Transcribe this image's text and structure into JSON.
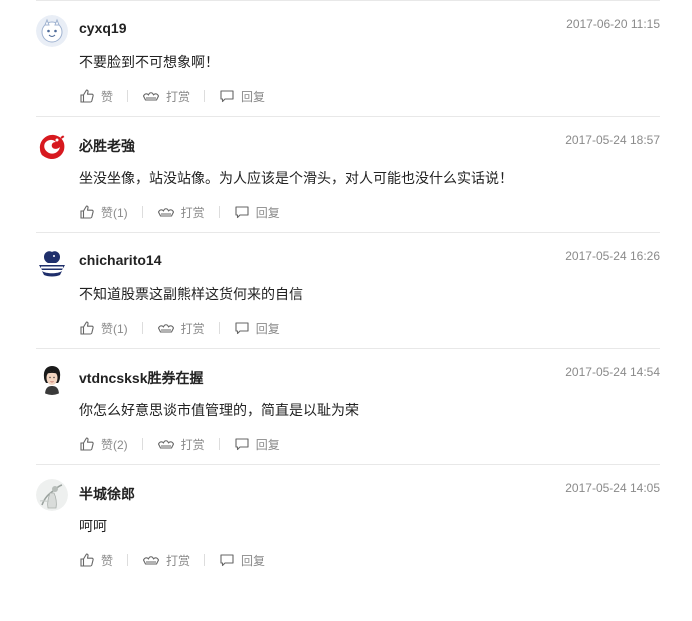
{
  "comments": [
    {
      "username": "cyxq19",
      "time": "2017-06-20 11:15",
      "content": "不要脸到不可想象啊！",
      "like_label": "赞",
      "reward_label": "打赏",
      "reply_label": "回复",
      "avatar_icon": "cartoon-face-icon"
    },
    {
      "username": "必胜老強",
      "time": "2017-05-24 18:57",
      "content": "坐没坐像，站没站像。为人应该是个滑头，对人可能也没什么实话说！",
      "like_label": "赞(1)",
      "reward_label": "打赏",
      "reply_label": "回复",
      "avatar_icon": "red-dragon-icon"
    },
    {
      "username": "chicharito14",
      "time": "2017-05-24 16:26",
      "content": "不知道股票这副熊样这货何来的自信",
      "like_label": "赞(1)",
      "reward_label": "打赏",
      "reply_label": "回复",
      "avatar_icon": "lion-crest-icon"
    },
    {
      "username": "vtdncsksk胜券在握",
      "time": "2017-05-24 14:54",
      "content": "你怎么好意思谈市值管理的，简直是以耻为荣",
      "like_label": "赞(2)",
      "reward_label": "打赏",
      "reply_label": "回复",
      "avatar_icon": "person-portrait-icon"
    },
    {
      "username": "半城徐郎",
      "time": "2017-05-24 14:05",
      "content": "呵呵",
      "like_label": "赞",
      "reward_label": "打赏",
      "reply_label": "回复",
      "avatar_icon": "ink-figure-icon"
    }
  ],
  "colors": {
    "text": "#222222",
    "muted": "#8a8a8a",
    "divider": "#e8e8e8",
    "dragon_red": "#d7191f"
  }
}
